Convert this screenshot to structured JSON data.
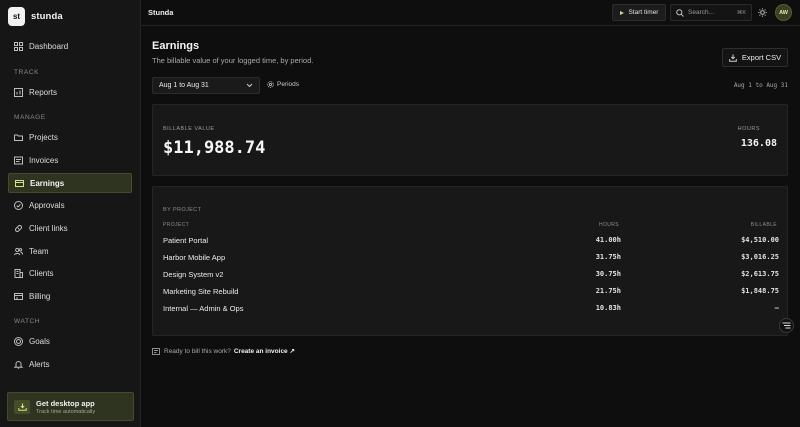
{
  "brand": {
    "logo_text": "st",
    "name": "stunda"
  },
  "sidebar": {
    "dashboard": "Dashboard",
    "sections": {
      "track": "TRACK",
      "manage": "MANAGE",
      "watch": "WATCH"
    },
    "items": [
      {
        "label": "Reports",
        "icon": "bar-chart-icon"
      },
      {
        "label": "Projects",
        "icon": "folder-icon"
      },
      {
        "label": "Invoices",
        "icon": "invoice-icon"
      },
      {
        "label": "Earnings",
        "icon": "wallet-icon",
        "active": true
      },
      {
        "label": "Approvals",
        "icon": "check-circle-icon"
      },
      {
        "label": "Client links",
        "icon": "link-icon"
      },
      {
        "label": "Team",
        "icon": "users-icon"
      },
      {
        "label": "Clients",
        "icon": "building-icon"
      },
      {
        "label": "Billing",
        "icon": "credit-card-icon"
      },
      {
        "label": "Goals",
        "icon": "target-icon"
      },
      {
        "label": "Alerts",
        "icon": "bell-icon"
      }
    ],
    "promo": {
      "title": "Get desktop app",
      "subtitle": "Track time automatically"
    }
  },
  "topbar": {
    "title": "Stunda",
    "start_timer": "Start timer",
    "search_placeholder": "Search...",
    "search_shortcut": "⌘K",
    "avatar_initials": "AW"
  },
  "page": {
    "title": "Earnings",
    "subtitle": "The billable value of your logged time, by period.",
    "export_label": "Export CSV",
    "range_value": "Aug 1 to Aug 31",
    "periods_label": "Periods",
    "range_label": "Aug 1 to Aug 31"
  },
  "summary": {
    "billable_caption": "BILLABLE VALUE",
    "billable_value": "$11,988.74",
    "hours_caption": "HOURS",
    "hours_value": "136.08"
  },
  "table": {
    "section_caption": "BY PROJECT",
    "col_project": "PROJECT",
    "col_hours": "HOURS",
    "col_billable": "BILLABLE",
    "rows": [
      {
        "project": "Patient Portal",
        "hours": "41.00h",
        "billable": "$4,510.00"
      },
      {
        "project": "Harbor Mobile App",
        "hours": "31.75h",
        "billable": "$3,016.25"
      },
      {
        "project": "Design System v2",
        "hours": "30.75h",
        "billable": "$2,613.75"
      },
      {
        "project": "Marketing Site Rebuild",
        "hours": "21.75h",
        "billable": "$1,848.75"
      },
      {
        "project": "Internal — Admin & Ops",
        "hours": "10.83h",
        "billable": "—"
      }
    ]
  },
  "footer": {
    "prompt": "Ready to bill this work?",
    "link": "Create an invoice ↗"
  },
  "colors": {
    "accent": "#2f3420",
    "accent_text": "#d8e08a",
    "background": "#0e0e0e",
    "panel": "#181818"
  }
}
